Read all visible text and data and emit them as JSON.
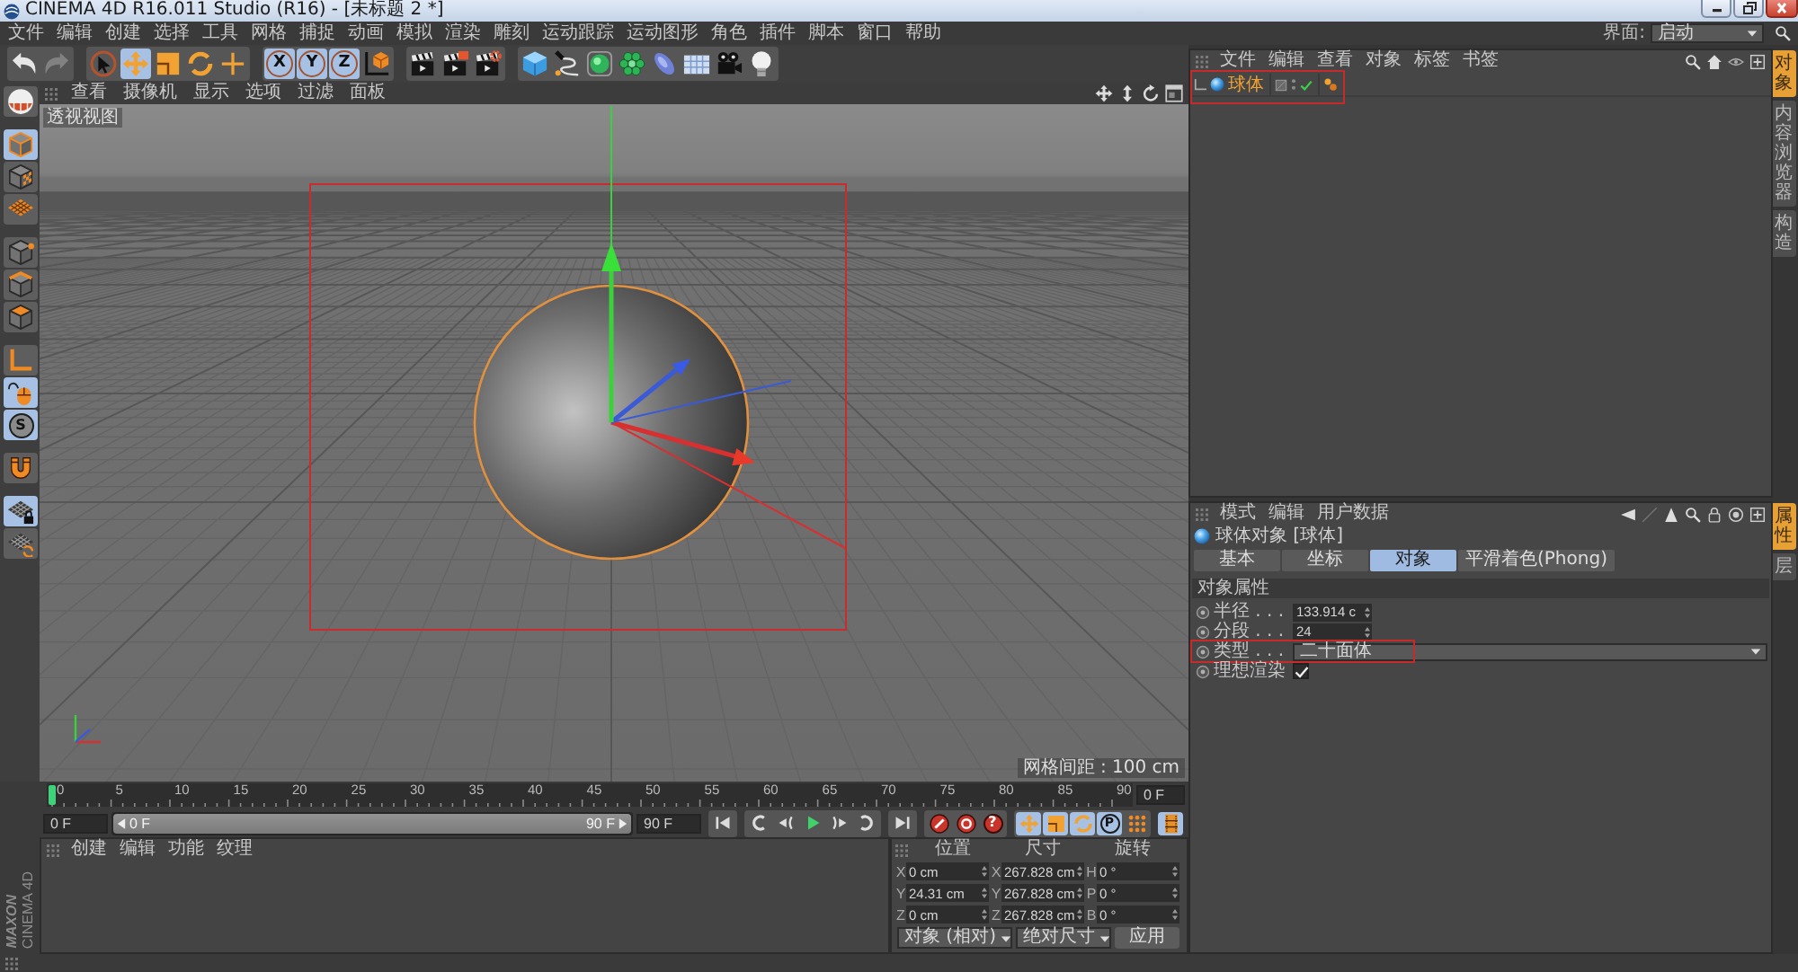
{
  "window": {
    "title": "CINEMA 4D R16.011 Studio (R16) - [未标题 2 *]",
    "controls": [
      {
        "kind": "minimize"
      },
      {
        "kind": "restore"
      },
      {
        "kind": "close"
      }
    ]
  },
  "menu_bar": {
    "items": [
      "文件",
      "编辑",
      "创建",
      "选择",
      "工具",
      "网格",
      "捕捉",
      "动画",
      "模拟",
      "渲染",
      "雕刻",
      "运动跟踪",
      "运动图形",
      "角色",
      "插件",
      "脚本",
      "窗口",
      "帮助"
    ],
    "layout_label": "界面:",
    "layout_value": "启动"
  },
  "toolbar": {
    "groups": [
      {
        "tools": [
          {
            "kind": "undo",
            "selected": false,
            "disabled": false
          },
          {
            "kind": "redo",
            "selected": false,
            "disabled": true
          }
        ]
      },
      {
        "tools": [
          {
            "kind": "select",
            "selected": false,
            "disabled": false
          },
          {
            "kind": "move",
            "selected": true,
            "disabled": false
          },
          {
            "kind": "scale",
            "selected": false,
            "disabled": false
          },
          {
            "kind": "rotate",
            "selected": false,
            "disabled": false
          },
          {
            "kind": "transform",
            "selected": false,
            "disabled": false
          }
        ]
      },
      {
        "tools": [
          {
            "kind": "axis",
            "label": "X",
            "selected": true,
            "disabled": false
          },
          {
            "kind": "axis",
            "label": "Y",
            "selected": true,
            "disabled": false
          },
          {
            "kind": "axis",
            "label": "Z",
            "selected": true,
            "disabled": false
          },
          {
            "kind": "coordinates",
            "selected": false,
            "disabled": false
          }
        ]
      },
      {
        "tools": [
          {
            "kind": "render_view",
            "selected": false,
            "disabled": false
          },
          {
            "kind": "render_picture",
            "selected": false,
            "disabled": false
          },
          {
            "kind": "render_settings",
            "selected": false,
            "disabled": false
          }
        ]
      },
      {
        "tools": [
          {
            "kind": "cube",
            "selected": false,
            "disabled": false
          },
          {
            "kind": "pen",
            "selected": false,
            "disabled": false
          },
          {
            "kind": "subdivision",
            "selected": false,
            "disabled": false
          },
          {
            "kind": "cloner",
            "selected": false,
            "disabled": false
          },
          {
            "kind": "deformer",
            "selected": false,
            "disabled": false
          },
          {
            "kind": "floor",
            "selected": false,
            "disabled": false
          },
          {
            "kind": "camera",
            "selected": false,
            "disabled": false
          },
          {
            "kind": "light",
            "selected": false,
            "disabled": false
          }
        ]
      }
    ]
  },
  "mode_bar": {
    "groups": [
      {
        "tools": [
          {
            "kind": "make_editable",
            "selected": false
          }
        ]
      },
      {
        "tools": [
          {
            "kind": "model",
            "selected": true
          },
          {
            "kind": "texture",
            "selected": false
          },
          {
            "kind": "workplane",
            "selected": false
          }
        ]
      },
      {
        "tools": [
          {
            "kind": "points",
            "selected": false
          },
          {
            "kind": "edges",
            "selected": false
          },
          {
            "kind": "polygons",
            "selected": false
          }
        ]
      },
      {
        "tools": [
          {
            "kind": "axis",
            "selected": false
          },
          {
            "kind": "tweak",
            "selected": true
          },
          {
            "kind": "solo",
            "label": "S",
            "selected": true
          }
        ]
      },
      {
        "tools": [
          {
            "kind": "snap",
            "selected": false
          }
        ]
      },
      {
        "tools": [
          {
            "kind": "lock_workplane",
            "selected": true
          },
          {
            "kind": "planar_workplane",
            "selected": false
          }
        ]
      }
    ]
  },
  "viewport": {
    "menu": [
      "查看",
      "摄像机",
      "显示",
      "选项",
      "过滤",
      "面板"
    ],
    "view_label": "透视视图",
    "grid_spacing": "网格间距 : 100 cm"
  },
  "timeline": {
    "ticks": [
      "0",
      "5",
      "10",
      "15",
      "20",
      "25",
      "30",
      "35",
      "40",
      "45",
      "50",
      "55",
      "60",
      "65",
      "70",
      "75",
      "80",
      "85",
      "90"
    ],
    "current_frame": "0 F"
  },
  "playback": {
    "start": "0 F",
    "range": {
      "start": "0 F",
      "end": "90 F",
      "level": 1
    },
    "end": "90 F",
    "transport": [
      {
        "kind": "go_start"
      },
      {
        "kind": "prev_key"
      },
      {
        "kind": "prev_frame"
      },
      {
        "kind": "play"
      },
      {
        "kind": "next_frame"
      },
      {
        "kind": "next_key"
      },
      {
        "kind": "go_end"
      }
    ],
    "record": [
      {
        "kind": "record"
      },
      {
        "kind": "autokey"
      },
      {
        "kind": "keyframe_selection",
        "label": "?"
      }
    ],
    "key_types": [
      {
        "kind": "move",
        "selected": true
      },
      {
        "kind": "scale",
        "selected": true
      },
      {
        "kind": "rotate",
        "selected": true
      },
      {
        "kind": "parameter",
        "label": "P",
        "selected": true
      },
      {
        "kind": "point_level",
        "selected": false
      }
    ],
    "timeline_button": {
      "selected": true
    }
  },
  "material_manager": {
    "menu": [
      "创建",
      "编辑",
      "功能",
      "纹理"
    ]
  },
  "coordinates": {
    "headers": [
      "位置",
      "尺寸",
      "旋转"
    ],
    "rows": [
      {
        "position_axis": "X",
        "position": "0 cm",
        "size_axis": "X",
        "size": "267.828 cm",
        "rotation_axis": "H",
        "rotation": "0 °"
      },
      {
        "position_axis": "Y",
        "position": "24.31 cm",
        "size_axis": "Y",
        "size": "267.828 cm",
        "rotation_axis": "P",
        "rotation": "0 °"
      },
      {
        "position_axis": "Z",
        "position": "0 cm",
        "size_axis": "Z",
        "size": "267.828 cm",
        "rotation_axis": "B",
        "rotation": "0 °"
      }
    ],
    "mode": "对象 (相对)",
    "size_mode": "绝对尺寸",
    "apply": "应用"
  },
  "logo": {
    "brand": "MAXON",
    "product": "CINEMA 4D"
  },
  "object_manager": {
    "menu": [
      "文件",
      "编辑",
      "查看",
      "对象",
      "标签",
      "书签"
    ],
    "objects": [
      {
        "name": "球体",
        "selected": true,
        "enabled": true,
        "highlighted": true
      }
    ],
    "side_tabs": [
      {
        "label": "对象",
        "selected": true
      },
      {
        "label": "内容浏览器",
        "selected": false
      },
      {
        "label": "构造",
        "selected": false
      }
    ]
  },
  "attribute_manager": {
    "menu": [
      "模式",
      "编辑",
      "用户数据"
    ],
    "title": "球体对象 [球体]",
    "tabs": [
      {
        "label": "基本",
        "selected": false
      },
      {
        "label": "坐标",
        "selected": false
      },
      {
        "label": "对象",
        "selected": true
      },
      {
        "label": "平滑着色(Phong)",
        "selected": false
      }
    ],
    "section": "对象属性",
    "fields": [
      {
        "kind": "number",
        "label": "半径 . . .",
        "value": "133.914 c",
        "highlighted": false
      },
      {
        "kind": "number",
        "label": "分段 . . .",
        "value": "24",
        "highlighted": false
      },
      {
        "kind": "dropdown",
        "label": "类型 . . .",
        "value": "二十面体",
        "highlighted": true
      },
      {
        "kind": "checkbox",
        "label": "理想渲染",
        "checked": true,
        "highlighted": false
      }
    ],
    "side_tabs": [
      {
        "label": "属性",
        "selected": true
      },
      {
        "label": "层",
        "selected": false
      }
    ]
  }
}
